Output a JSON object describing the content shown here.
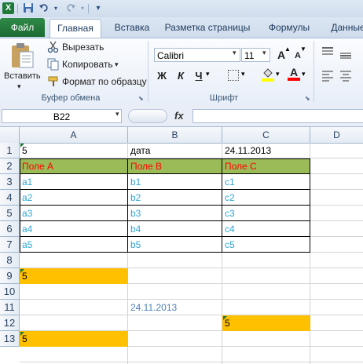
{
  "titlebar": {
    "logo": "X",
    "icons": [
      "excel-logo-icon",
      "save-icon",
      "undo-icon",
      "redo-icon",
      "customize-qat-icon"
    ]
  },
  "tabs": [
    {
      "label": "Файл"
    },
    {
      "label": "Главная"
    },
    {
      "label": "Вставка"
    },
    {
      "label": "Разметка страницы"
    },
    {
      "label": "Формулы"
    },
    {
      "label": "Данные"
    }
  ],
  "clipboard": {
    "paste_label": "Вставить",
    "cut_label": "Вырезать",
    "copy_label": "Копировать",
    "format_painter_label": "Формат по образцу",
    "group_label": "Буфер обмена"
  },
  "font": {
    "name": "Calibri",
    "size": "11",
    "bold": "Ж",
    "italic": "К",
    "underline": "Ч",
    "group_label": "Шрифт"
  },
  "formula_bar": {
    "name_box": "B22",
    "fx_label": "fx",
    "value": ""
  },
  "columns": [
    "A",
    "B",
    "C",
    "D"
  ],
  "rows": [
    "1",
    "2",
    "3",
    "4",
    "5",
    "6",
    "7",
    "8",
    "9",
    "10",
    "11",
    "12",
    "13"
  ],
  "cells": {
    "A1": "5",
    "B1": "дата",
    "C1": "24.11.2013",
    "A2": "Поле A",
    "B2": "Поле B",
    "C2": "Поле C",
    "A3": "a1",
    "B3": "b1",
    "C3": "c1",
    "A4": "a2",
    "B4": "b2",
    "C4": "c2",
    "A5": "a3",
    "B5": "b3",
    "C5": "c3",
    "A6": "a4",
    "B6": "b4",
    "C6": "c4",
    "A7": "a5",
    "B7": "b5",
    "C7": "c5",
    "A9": "5",
    "B11": "24.11.2013",
    "C12": "5",
    "A13": "5"
  },
  "colors": {
    "header_fill": "#9bbb59",
    "header_text": "#ff0000",
    "data_text": "#31a5d6",
    "highlight_fill": "#ffc000",
    "date_text": "#4f81bd",
    "file_tab": "#217a3c"
  }
}
